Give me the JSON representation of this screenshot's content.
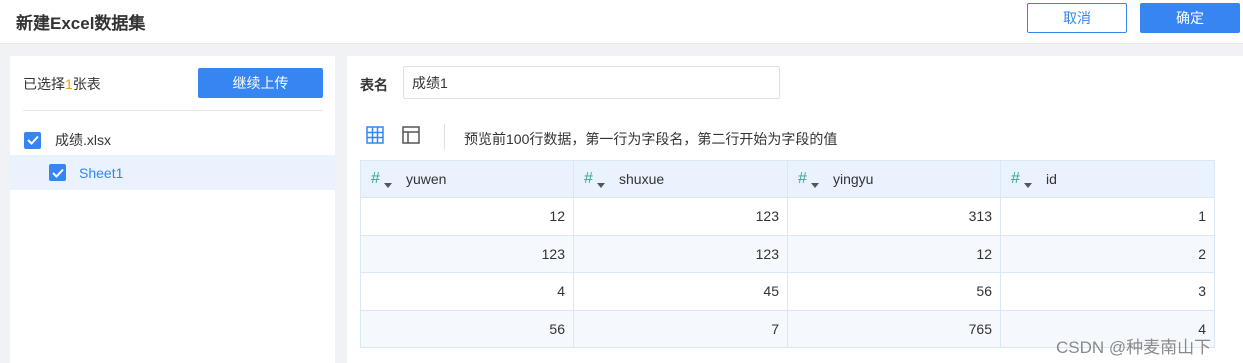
{
  "header": {
    "title": "新建Excel数据集",
    "cancel_label": "取消",
    "confirm_label": "确定"
  },
  "sidebar": {
    "selected_prefix": "已选择",
    "selected_count": "1",
    "selected_suffix": "张表",
    "upload_label": "继续上传",
    "file": {
      "name": "成绩.xlsx",
      "checked": true
    },
    "sheet": {
      "name": "Sheet1",
      "checked": true
    }
  },
  "main": {
    "table_name_label": "表名",
    "table_name_value": "成绩1",
    "preview_hint": "预览前100行数据，第一行为字段名，第二行开始为字段的值",
    "columns": [
      {
        "name": "yuwen",
        "type_icon": "number-hash-icon"
      },
      {
        "name": "shuxue",
        "type_icon": "number-hash-icon"
      },
      {
        "name": "yingyu",
        "type_icon": "number-hash-icon"
      },
      {
        "name": "id",
        "type_icon": "number-hash-icon"
      }
    ],
    "rows": [
      [
        "12",
        "123",
        "313",
        "1"
      ],
      [
        "123",
        "123",
        "12",
        "2"
      ],
      [
        "4",
        "45",
        "56",
        "3"
      ],
      [
        "56",
        "7",
        "765",
        "4"
      ]
    ]
  },
  "watermark": "CSDN @种麦南山下",
  "colors": {
    "accent": "#3685f2",
    "count_highlight": "#f39c12",
    "type_icon": "#3aa68c",
    "header_bg": "#eaf2fd"
  }
}
